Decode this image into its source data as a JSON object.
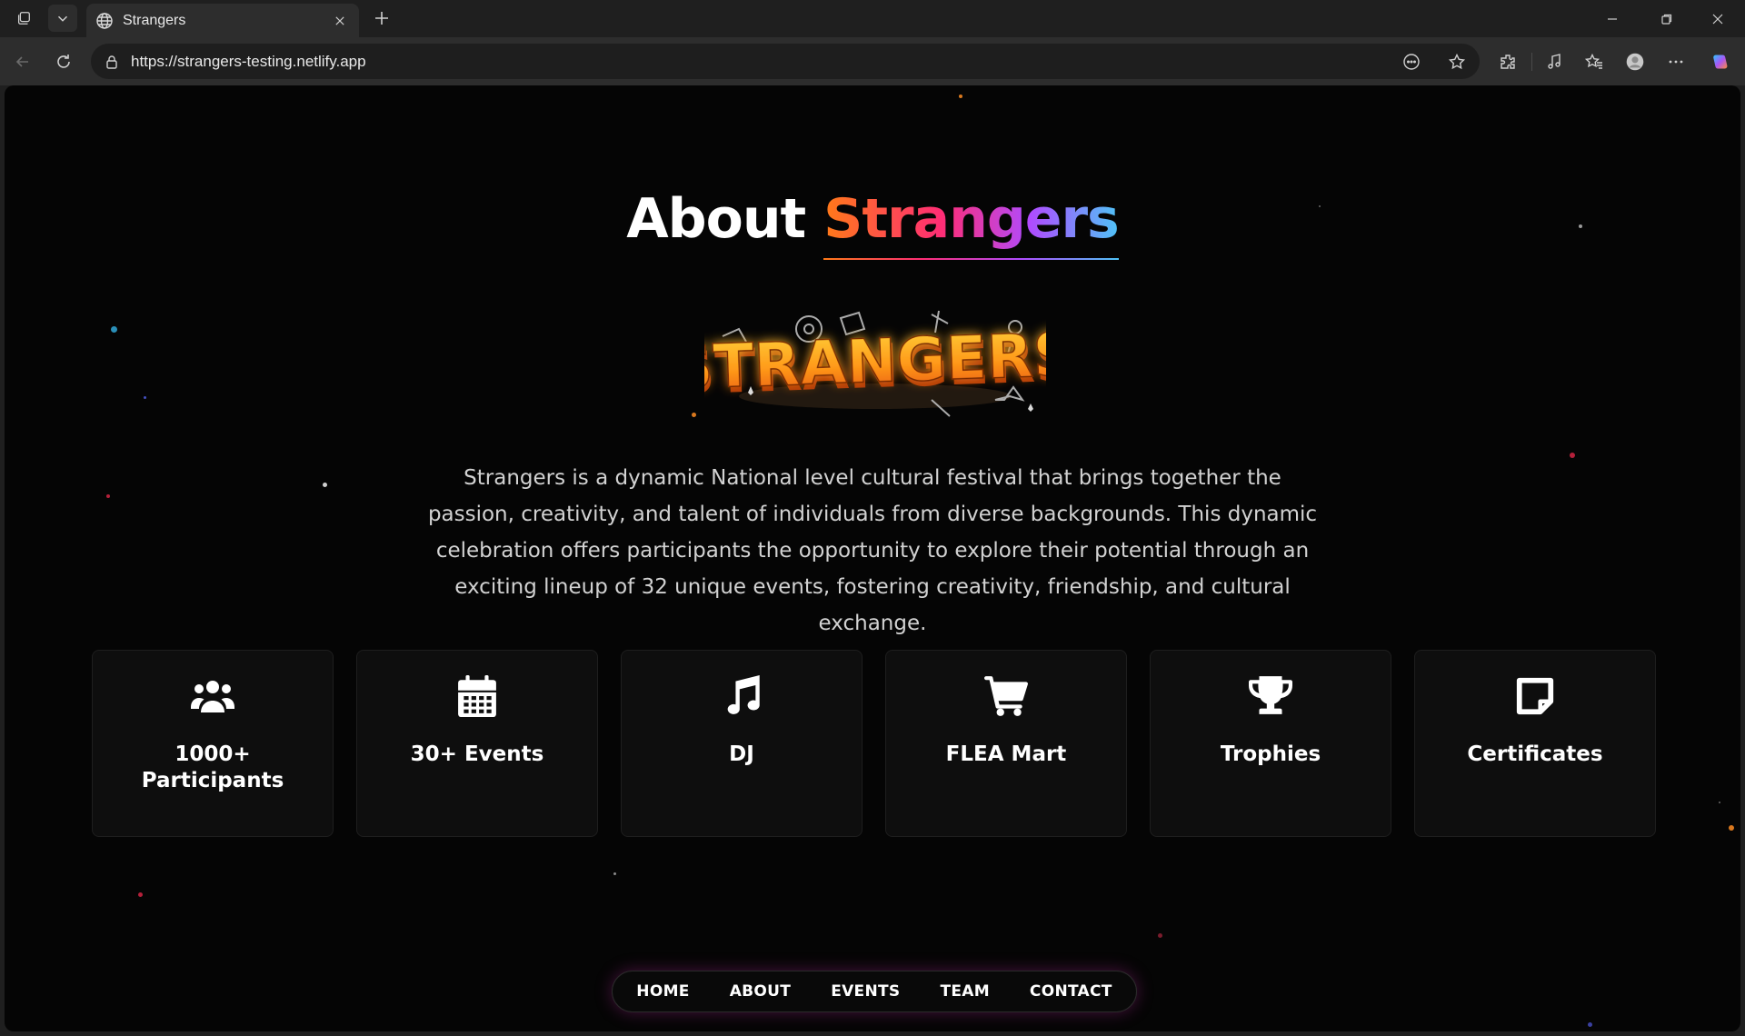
{
  "browser": {
    "tab_title": "Strangers",
    "url": "https://strangers-testing.netlify.app"
  },
  "page": {
    "heading_plain": "About ",
    "heading_accent": "Strangers",
    "logo_text": "STRANGERS",
    "description": "Strangers is a dynamic National level cultural festival that brings together the passion, creativity, and talent of individuals from diverse backgrounds. This dynamic celebration offers participants the opportunity to explore their potential through an exciting lineup of 32 unique events, fostering creativity, friendship, and cultural exchange.",
    "cards": [
      {
        "icon": "users-icon",
        "label_line1": "1000+",
        "label_line2": "Participants"
      },
      {
        "icon": "calendar-icon",
        "label": "30+ Events"
      },
      {
        "icon": "music-note-icon",
        "label": "DJ"
      },
      {
        "icon": "shopping-cart-icon",
        "label": "FLEA Mart"
      },
      {
        "icon": "trophy-icon",
        "label": "Trophies"
      },
      {
        "icon": "certificate-icon",
        "label": "Certificates"
      }
    ],
    "nav": [
      "HOME",
      "ABOUT",
      "EVENTS",
      "TEAM",
      "CONTACT"
    ]
  },
  "colors": {
    "background": "#050505",
    "card_bg": "#0e0e0e",
    "accent_gradient": [
      "#ff7a18",
      "#ff2d75",
      "#b04bff",
      "#4fc3f7"
    ],
    "nav_glow": "#be28a0"
  }
}
